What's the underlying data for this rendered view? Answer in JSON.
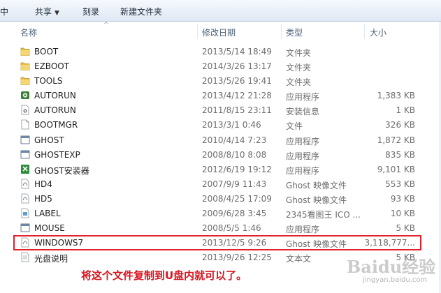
{
  "toolbar": {
    "partial_left": "中",
    "share": "共享",
    "burn": "刻录",
    "new_folder": "新建文件夹"
  },
  "columns": {
    "name": "名称",
    "date": "修改日期",
    "type": "类型",
    "size": "大小"
  },
  "files": [
    {
      "name": "BOOT",
      "date": "2013/5/14 18:49",
      "type": "文件夹",
      "size": "",
      "icon": "folder-icon"
    },
    {
      "name": "EZBOOT",
      "date": "2014/3/26 13:17",
      "type": "文件夹",
      "size": "",
      "icon": "folder-icon"
    },
    {
      "name": "TOOLS",
      "date": "2013/5/26 19:41",
      "type": "文件夹",
      "size": "",
      "icon": "folder-icon"
    },
    {
      "name": "AUTORUN",
      "date": "2013/4/12 21:28",
      "type": "应用程序",
      "size": "1,383 KB",
      "icon": "autorun-app-icon"
    },
    {
      "name": "AUTORUN",
      "date": "2011/8/15 23:11",
      "type": "安装信息",
      "size": "1 KB",
      "icon": "settings-file-icon"
    },
    {
      "name": "BOOTMGR",
      "date": "2013/3/1 0:46",
      "type": "文件",
      "size": "326 KB",
      "icon": "blank-file-icon"
    },
    {
      "name": "GHOST",
      "date": "2010/4/14 7:23",
      "type": "应用程序",
      "size": "1,872 KB",
      "icon": "app-window-icon"
    },
    {
      "name": "GHOSTEXP",
      "date": "2008/8/10 8:08",
      "type": "应用程序",
      "size": "835 KB",
      "icon": "app-window-icon"
    },
    {
      "name": "GHOST安装器",
      "date": "2012/6/19 19:12",
      "type": "应用程序",
      "size": "9,101 KB",
      "icon": "installer-icon"
    },
    {
      "name": "HD4",
      "date": "2007/9/9 11:43",
      "type": "Ghost 映像文件",
      "size": "553 KB",
      "icon": "ghost-image-icon"
    },
    {
      "name": "HD5",
      "date": "2008/4/25 17:09",
      "type": "Ghost 映像文件",
      "size": "93 KB",
      "icon": "ghost-image-icon"
    },
    {
      "name": "LABEL",
      "date": "2009/6/28 3:45",
      "type": "2345看图王 ICO ...",
      "size": "10 KB",
      "icon": "ico-file-icon"
    },
    {
      "name": "MOUSE",
      "date": "2008/5/5 1:46",
      "type": "应用程序",
      "size": "5 KB",
      "icon": "app-window-icon"
    },
    {
      "name": "WINDOWS7",
      "date": "2013/12/5 9:26",
      "type": "Ghost 映像文件",
      "size": "3,118,777...",
      "icon": "ghost-image-icon"
    },
    {
      "name": "光盘说明",
      "date": "2013/9/26 12:25",
      "type": "文本文",
      "size": "5 KB",
      "icon": "text-file-icon"
    }
  ],
  "annotation": "将这个文件复制到U盘内就可以了。",
  "watermark": {
    "logo": "Baidu经验",
    "url": "jingyan.baidu.com"
  },
  "colors": {
    "highlight": "#e0202a",
    "annotation": "#d8141e",
    "folder": "#e8c04a"
  }
}
